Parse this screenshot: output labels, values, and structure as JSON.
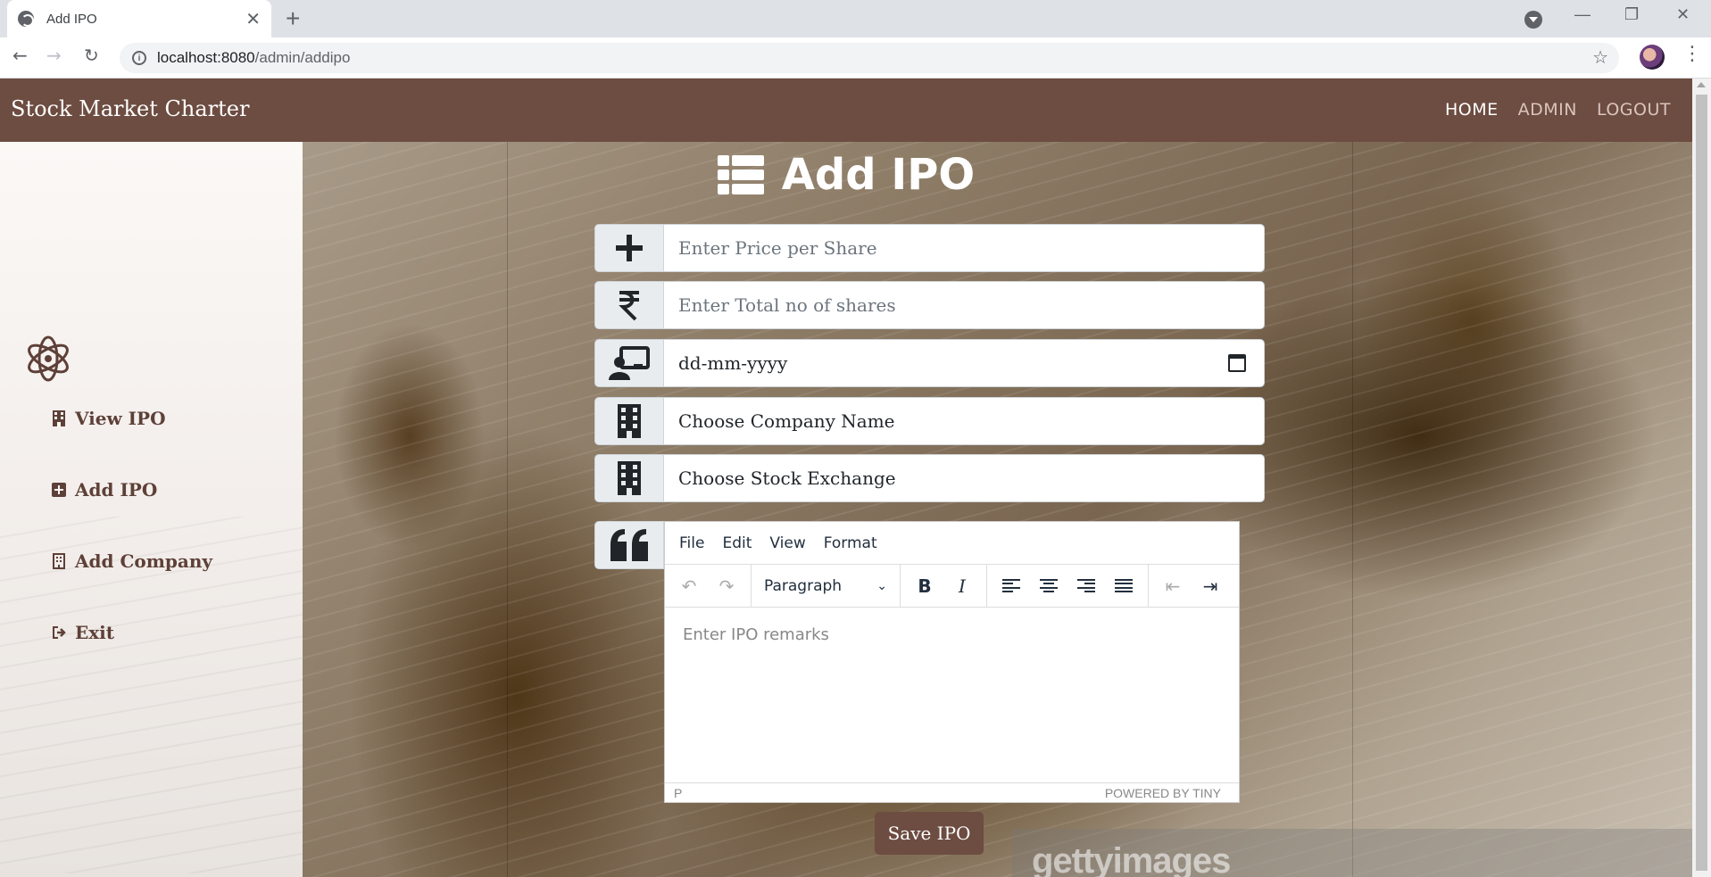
{
  "browser": {
    "tab_title": "Add IPO",
    "tab_close": "✕",
    "new_tab": "+",
    "url_host": "localhost:8080",
    "url_path": "/admin/addipo",
    "window_controls": [
      "—",
      "❐",
      "✕"
    ]
  },
  "app": {
    "brand": "Stock Market Charter",
    "nav": [
      "HOME",
      "ADMIN",
      "LOGOUT"
    ],
    "accent_color": "#6d4c41"
  },
  "sidebar": {
    "items": [
      {
        "label": "View IPO",
        "icon": "building-icon"
      },
      {
        "label": "Add IPO",
        "icon": "plus-square-icon"
      },
      {
        "label": "Add Company",
        "icon": "building-outline-icon"
      },
      {
        "label": "Exit",
        "icon": "sign-out-icon"
      }
    ]
  },
  "form": {
    "title": "Add IPO",
    "price_placeholder": "Enter Price per Share",
    "shares_placeholder": "Enter Total no of shares",
    "date_value": "dd-mm-yyyy",
    "company_select": "Choose Company Name",
    "exchange_select": "Choose Stock Exchange",
    "save_label": "Save IPO"
  },
  "editor": {
    "menu": [
      "File",
      "Edit",
      "View",
      "Format"
    ],
    "block_format": "Paragraph",
    "placeholder": "Enter IPO remarks",
    "status_path": "P",
    "powered_by": "POWERED BY TINY"
  },
  "watermark": "gettyimages"
}
